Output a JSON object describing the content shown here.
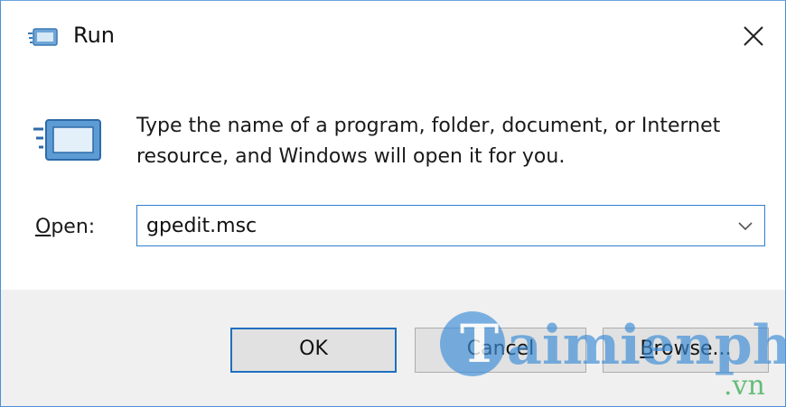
{
  "window": {
    "title": "Run",
    "title_icon": "run-icon",
    "close_icon": "close-icon"
  },
  "content": {
    "icon": "run-icon",
    "description": "Type the name of a program, folder, document, or Internet resource, and Windows will open it for you.",
    "open_label_accel": "O",
    "open_label_rest": "pen:",
    "open_value": "gpedit.msc",
    "dropdown_icon": "chevron-down-icon"
  },
  "buttons": {
    "ok": "OK",
    "cancel": "Cancel",
    "browse_accel": "B",
    "browse_rest": "rowse..."
  },
  "watermark": {
    "brand": "aimienphi",
    "domain": ".vn"
  },
  "colors": {
    "accent": "#1f6fc1",
    "footer_bg": "#f0f0f0",
    "watermark_blue": "#3d8ed8",
    "watermark_green": "#2aa84a"
  }
}
